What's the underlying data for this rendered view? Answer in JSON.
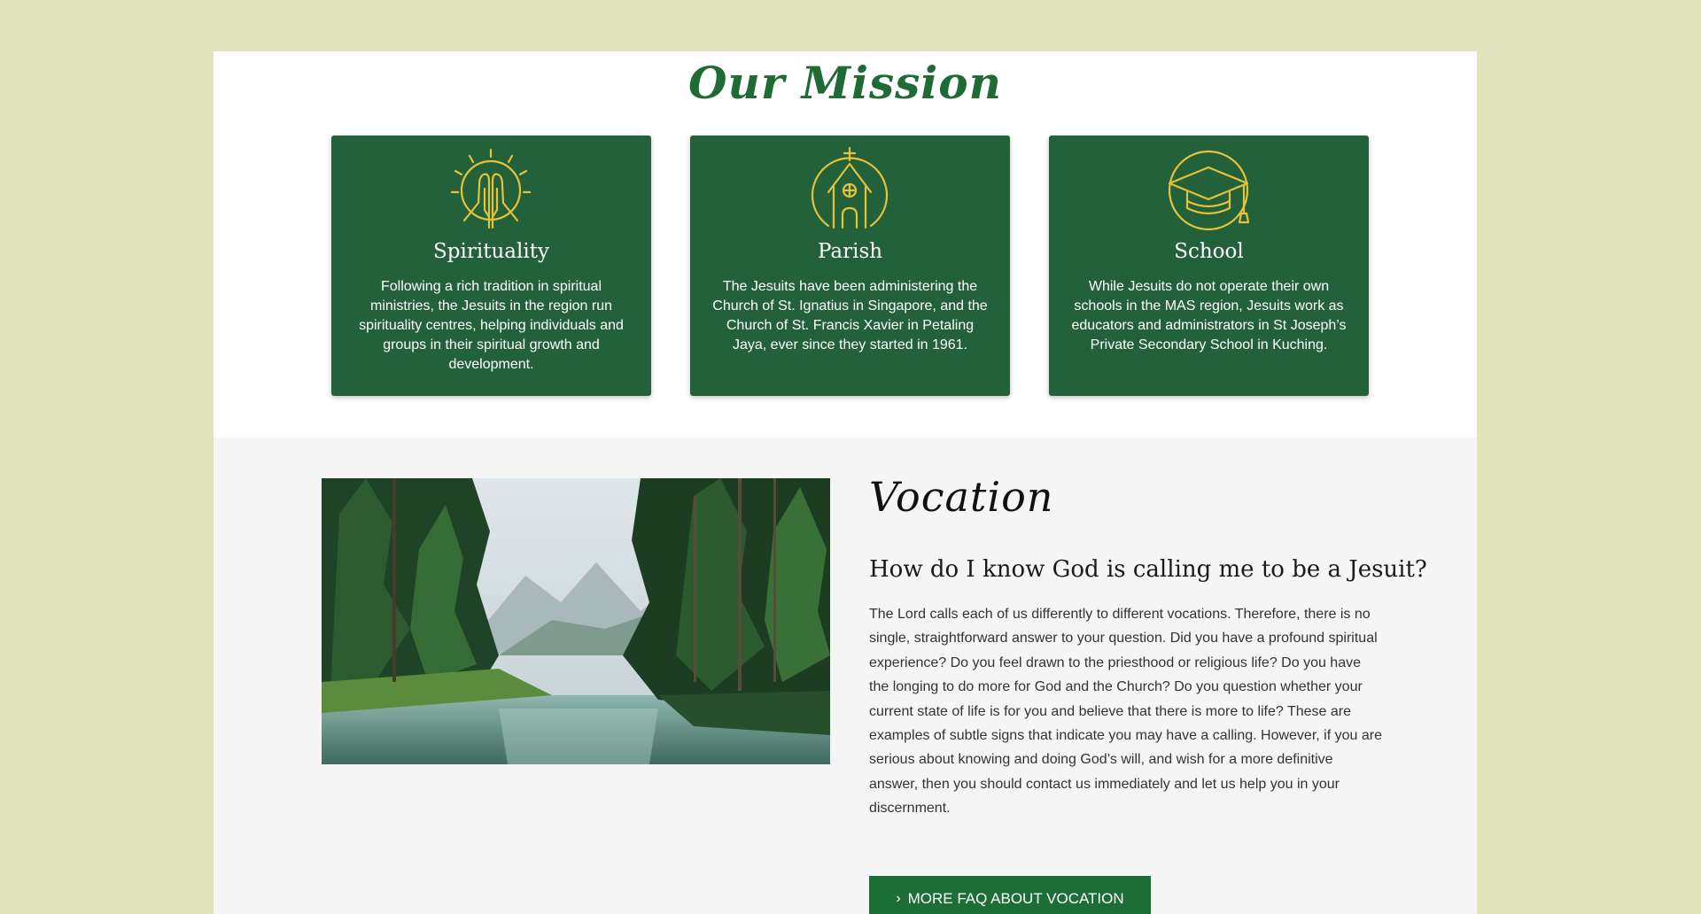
{
  "mission": {
    "title": "Our Mission",
    "cards": [
      {
        "icon": "praying-hands-icon",
        "title": "Spirituality",
        "text": "Following a rich tradition in spiritual ministries, the Jesuits in the region run spirituality centres, helping individuals and groups in their spiritual growth and development."
      },
      {
        "icon": "church-icon",
        "title": "Parish",
        "text": "The Jesuits have been administering the Church of St. Ignatius in Singapore, and the Church of St. Francis Xavier in Petaling Jaya, ever since they started in 1961."
      },
      {
        "icon": "graduation-cap-icon",
        "title": "School",
        "text": "While Jesuits do not operate their own schools in the MAS region, Jesuits work as educators and administrators in St Joseph’s Private Secondary School in Kuching."
      }
    ]
  },
  "vocation": {
    "title": "Vocation",
    "subtitle": "How do I know God is calling me to be a Jesuit?",
    "body": "The Lord calls each of us differently to different vocations. Therefore, there is no single, straightforward answer to your question. Did you have a profound spiritual experience? Do you feel drawn to the priesthood or religious life? Do you have the longing to do more for God and the Church? Do you question whether your current state of life is for you and believe that there is more to life? These are examples of subtle signs that indicate you may have a calling. However, if you are serious about knowing and doing God’s will, and wish for a more definitive answer, then you should contact us immediately and let us help you in your discernment.",
    "button_label": "MORE FAQ ABOUT VOCATION",
    "button_icon": "chevron-right-icon"
  },
  "colors": {
    "background": "#e0e3bc",
    "card": "#23613a",
    "accent_green": "#1b6e35",
    "icon_gold": "#e5c23a"
  }
}
